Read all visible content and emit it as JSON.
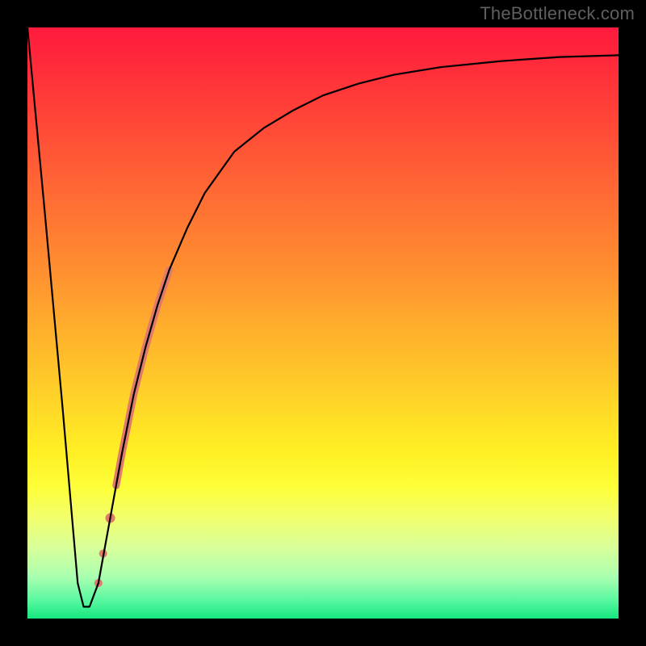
{
  "watermark": "TheBottleneck.com",
  "chart_data": {
    "type": "line",
    "title": "",
    "xlabel": "",
    "ylabel": "",
    "xlim": [
      0,
      100
    ],
    "ylim": [
      0,
      100
    ],
    "grid": false,
    "legend": false,
    "background_gradient": {
      "direction": "vertical",
      "stops": [
        {
          "pos": 0.0,
          "color": "#ff1a3d"
        },
        {
          "pos": 0.5,
          "color": "#ffb22c"
        },
        {
          "pos": 0.78,
          "color": "#fdff3a"
        },
        {
          "pos": 1.0,
          "color": "#15e77f"
        }
      ]
    },
    "series": [
      {
        "name": "bottleneck-curve",
        "color": "#000000",
        "stroke_width": 2,
        "x": [
          0,
          3,
          6,
          8.5,
          9.5,
          10.5,
          12,
          14,
          16,
          18,
          20,
          22,
          24,
          27,
          30,
          35,
          40,
          45,
          50,
          56,
          62,
          70,
          80,
          90,
          100
        ],
        "y": [
          100,
          68,
          35,
          6,
          2,
          2,
          6,
          17,
          28,
          38,
          46,
          53,
          59,
          66,
          72,
          79,
          83,
          86,
          88.5,
          90.5,
          92,
          93.3,
          94.3,
          95,
          95.3
        ]
      }
    ],
    "highlights": {
      "name": "highlighted-segment",
      "color": "#e07a6b",
      "segment": {
        "x_start": 15,
        "x_end": 24,
        "stroke_width": 9
      },
      "dots": [
        {
          "x": 14.0,
          "y": 17,
          "r": 6
        },
        {
          "x": 12.8,
          "y": 11,
          "r": 5
        },
        {
          "x": 12.0,
          "y": 6,
          "r": 5
        }
      ]
    }
  }
}
